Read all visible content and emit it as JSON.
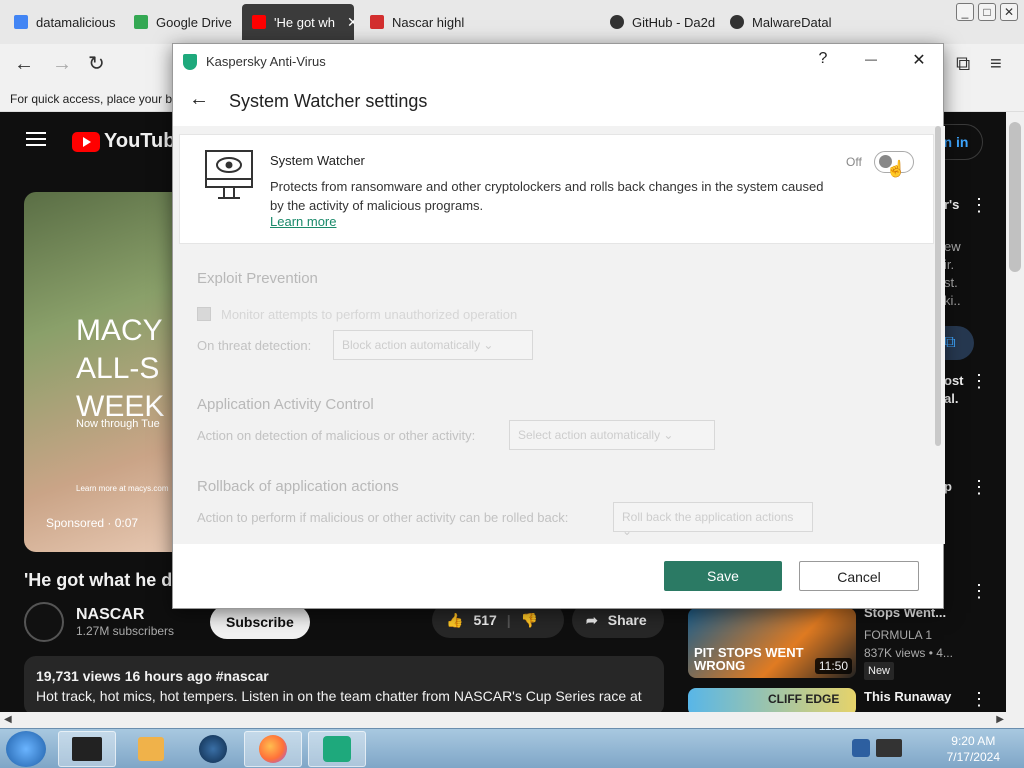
{
  "browser": {
    "tabs": [
      {
        "label": "datamalicious",
        "color": "#4285f4"
      },
      {
        "label": "Google Drive",
        "color": "#34a853"
      },
      {
        "label": "'He got wh",
        "color": "#ff0000",
        "active": true
      },
      {
        "label": "Nascar highl",
        "color": "#d32f2f"
      },
      {
        "label": "GitHub - Da2d",
        "color": "#333333"
      },
      {
        "label": "MalwareDatal",
        "color": "#333333"
      }
    ],
    "close_glyph": "✕",
    "bookmarks_text": "For quick access, place your bo"
  },
  "youtube": {
    "logo_text": "YouTube",
    "sign_in": "gn in",
    "video_title": "'He got what he d",
    "ad_lines": [
      "MACY",
      "ALL-S",
      "WEEK"
    ],
    "ad_small": "Now through Tue",
    "ad_footer": "Learn more at macys.com",
    "sponsored": "Sponsored · 0:07",
    "channel_name": "NASCAR",
    "subscribers": "1.27M subscribers",
    "subscribe_label": "Subscribe",
    "likes": "517",
    "share_label": "Share",
    "views_line": "19,731 views  16 hours ago  #nascar",
    "description": "Hot track, hot mics, hot tempers. Listen in on the team chatter from NASCAR's Cup Series race at",
    "sidebar": [
      {
        "title": "Stops Went...",
        "channel": "FORMULA 1",
        "views": "837K views • 4...",
        "badge": "New",
        "duration": "11:50",
        "thumb_text": "PIT STOPS WENT WRONG"
      },
      {
        "title": "This Runaway",
        "thumb_text": "CLIFF EDGE"
      }
    ],
    "side_fragments": [
      "r's",
      "ew",
      "ir.",
      "st.",
      "ki..",
      "ost",
      "al.",
      "p"
    ]
  },
  "dialog": {
    "app_name": "Kaspersky Anti-Virus",
    "help": "?",
    "minimize": "—",
    "close": "✕",
    "back_icon": "←",
    "heading": "System Watcher settings",
    "feature_name": "System Watcher",
    "feature_desc": "Protects from ransomware and other cryptolockers and rolls back changes in the system caused by the activity of malicious programs.",
    "learn_more": "Learn more",
    "toggle_state": "Off",
    "sections": [
      {
        "title": "Exploit Prevention",
        "checkbox_label": "Monitor attempts to perform unauthorized operation",
        "row_label": "On threat detection:",
        "dropdown": "Block action automatically"
      },
      {
        "title": "Application Activity Control",
        "row_label": "Action on detection of malicious or other activity:",
        "dropdown": "Select action automatically"
      },
      {
        "title": "Rollback of application actions",
        "row_label": "Action to perform if malicious or other activity can be rolled back:",
        "dropdown": "Roll back the application actions"
      }
    ],
    "save_label": "Save",
    "cancel_label": "Cancel"
  },
  "taskbar": {
    "time": "9:20 AM",
    "date": "7/17/2024"
  }
}
